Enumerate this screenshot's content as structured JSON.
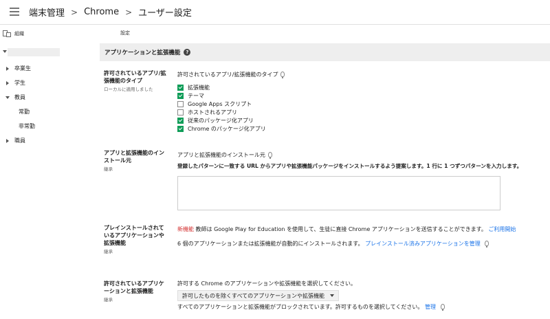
{
  "header": {
    "breadcrumb": [
      "端末管理",
      "Chrome",
      "ユーザー設定"
    ],
    "separator": ">"
  },
  "sidebar": {
    "org_title": "組織",
    "items": [
      {
        "label": "卒業生",
        "expanded": false
      },
      {
        "label": "学生",
        "expanded": false
      },
      {
        "label": "教員",
        "expanded": true
      },
      {
        "label": "常勤",
        "child": true
      },
      {
        "label": "非常勤",
        "child": true
      },
      {
        "label": "職員",
        "expanded": false
      }
    ]
  },
  "main": {
    "settings_label": "設定",
    "section_title": "アプリケーションと拡張機能",
    "help_glyph": "?",
    "allowed_types": {
      "label_line1": "許可されているアプリ/拡",
      "label_line2": "張機能のタイプ",
      "sub": "ローカルに適用しました",
      "heading": "許可されているアプリ/拡張機能のタイプ",
      "options": [
        {
          "label": "拡張機能",
          "checked": true
        },
        {
          "label": "テーマ",
          "checked": true
        },
        {
          "label": "Google Apps スクリプト",
          "checked": false
        },
        {
          "label": "ホストされるアプリ",
          "checked": false
        },
        {
          "label": "従来のパッケージ化アプリ",
          "checked": true
        },
        {
          "label": "Chrome のパッケージ化アプリ",
          "checked": true
        }
      ]
    },
    "install_sources": {
      "label_line1": "アプリと拡張機能のイン",
      "label_line2": "ストール元",
      "sub": "継承",
      "heading": "アプリと拡張機能のインストール元",
      "description": "登録したパターンに一致する URL からアプリや拡張機能パッケージをインストールするよう提案します。1 行に 1 つずつパターンを入力します。",
      "textarea_value": ""
    },
    "preinstall": {
      "label_line1": "プレインストールされて",
      "label_line2": "いるアプリケーションや",
      "label_line3": "拡張機能",
      "sub": "継承",
      "new_label": "新機能",
      "new_text": "教師は Google Play for Education を使用して、生徒に直接 Chrome アプリケーションを送信することができます。",
      "new_link": "ご利用開始",
      "count_text": "6 個のアプリケーションまたは拡張機能が自動的にインストールされます。",
      "manage_link": "プレインストール済みアプリケーションを管理"
    },
    "allowed_apps": {
      "label_line1": "許可されているアプリケ",
      "label_line2": "ーションと拡張機能",
      "sub": "継承",
      "heading": "許可する Chrome のアプリケーションや拡張機能を選択してください。",
      "select_value": "許可したものを除くすべてのアプリケーションや拡張機能",
      "blocked_text": "すべてのアプリケーションと拡張機能がブロックされています。許可するものを選択してください。",
      "manage_link": "管理"
    }
  }
}
